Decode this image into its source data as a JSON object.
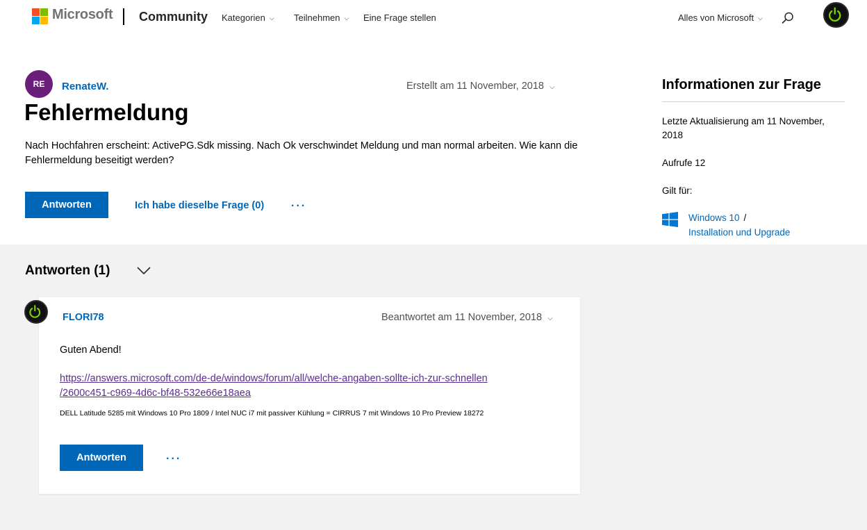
{
  "header": {
    "brand": "Microsoft",
    "site": "Community",
    "nav": [
      {
        "label": "Kategorien",
        "has_dropdown": true
      },
      {
        "label": "Teilnehmen",
        "has_dropdown": true
      },
      {
        "label": "Eine Frage stellen",
        "has_dropdown": false
      }
    ],
    "all_microsoft": "Alles von Microsoft",
    "icons": {
      "search": "search-icon",
      "profile": "power-icon"
    }
  },
  "question": {
    "author_initials": "RE",
    "author": "RenateW.",
    "created": "Erstellt am 11 November, 2018",
    "title": "Fehlermeldung",
    "body": "Nach Hochfahren erscheint: ActivePG.Sdk missing. Nach Ok verschwindet Meldung und man normal arbeiten. Wie kann die Fehlermeldung beseitigt werden?",
    "reply_label": "Antworten",
    "same_question_label": "Ich habe dieselbe Frage (0)",
    "more_label": "..."
  },
  "sidebar": {
    "title": "Informationen zur Frage",
    "last_updated": "Letzte Aktualisierung am 11 November, 2018",
    "views": "Aufrufe 12",
    "applies_to": "Gilt für:",
    "product_link": "Windows 10",
    "separator": "/",
    "category_link": "Installation und Upgrade"
  },
  "answers": {
    "heading": "Antworten (1)",
    "items": [
      {
        "author": "FLORI78",
        "date": "Beantwortet am 11 November, 2018",
        "greeting": "Guten Abend!",
        "link": "https://answers.microsoft.com/de-de/windows/forum/all/welche-angaben-sollte-ich-zur-schnellen/2600c451-c969-4d6c-bf48-532e66e18aea",
        "link_line1": "https://answers.microsoft.com/de-de/windows/forum/all/welche-angaben-sollte-ich-zur-schnellen",
        "link_line2": "/2600c451-c969-4d6c-bf48-532e66e18aea",
        "signature": "DELL Latitude 5285 mit Windows 10 Pro 1809 / Intel NUC i7 mit passiver Kühlung = CIRRUS 7 mit Windows 10 Pro Preview 18272",
        "reply_label": "Antworten",
        "more_label": "..."
      }
    ]
  },
  "colors": {
    "accent": "#0067b8",
    "avatar_purple": "#6b1f7b",
    "visited_link": "#5c2d91",
    "band_gray": "#f2f2f2",
    "power_green": "#7cd400"
  }
}
